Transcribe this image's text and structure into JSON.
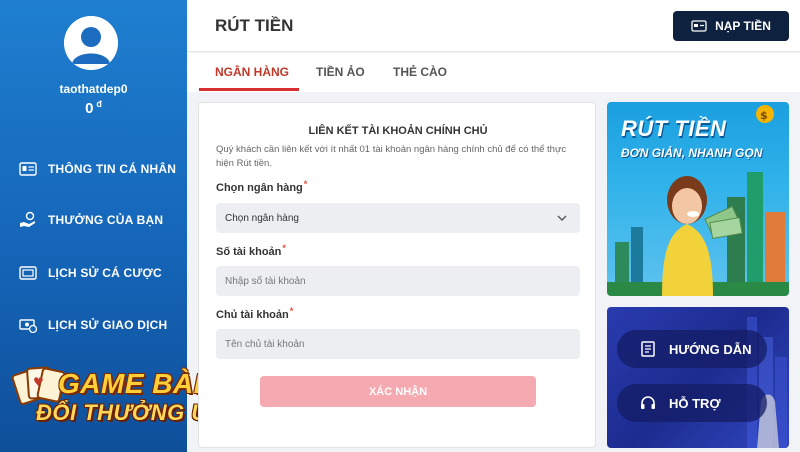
{
  "sidebar": {
    "username": "taothatdep0",
    "balance": "0",
    "currency": "đ",
    "items": [
      {
        "label": "THÔNG TIN CÁ NHÂN",
        "icon": "id-card-icon"
      },
      {
        "label": "THƯỞNG CỦA BẠN",
        "icon": "reward-hand-icon"
      },
      {
        "label": "LỊCH SỬ CÁ CƯỢC",
        "icon": "ticket-icon"
      },
      {
        "label": "LỊCH SỬ GIAO DỊCH",
        "icon": "money-history-icon"
      }
    ]
  },
  "watermark": {
    "line1": "GAME BÀI",
    "line2": "ĐỔI THƯỞNG UK"
  },
  "header": {
    "title": "RÚT TIỀN",
    "deposit_label": "NẠP TIỀN"
  },
  "tabs": [
    {
      "label": "NGÂN HÀNG",
      "active": true
    },
    {
      "label": "TIỀN ẢO",
      "active": false
    },
    {
      "label": "THẺ CÀO",
      "active": false
    }
  ],
  "form": {
    "title": "LIÊN KẾT TÀI KHOẢN CHÍNH CHỦ",
    "description": "Quý khách cần liên kết với ít nhất 01 tài khoản ngân hàng chính chủ để có thể thực hiện Rút tiền.",
    "bank_label": "Chọn ngân hàng",
    "bank_value": "Chọn ngân hàng",
    "account_number_label": "Số tài khoản",
    "account_number_placeholder": "Nhập số tài khoản",
    "account_holder_label": "Chủ tài khoản",
    "account_holder_placeholder": "Tên chủ tài khoản",
    "required_mark": "*",
    "submit_label": "XÁC NHẬN"
  },
  "promo": {
    "line1": "RÚT TIỀN",
    "line2": "ĐƠN GIẢN, NHANH GỌN"
  },
  "support": {
    "guide_label": "HƯỚNG DẪN",
    "help_label": "HỖ TRỢ"
  },
  "colors": {
    "accent": "#d63031",
    "sidebar": "#1a6fc4",
    "deposit_button": "#0e2240",
    "submit_disabled": "#f5a9b0"
  }
}
